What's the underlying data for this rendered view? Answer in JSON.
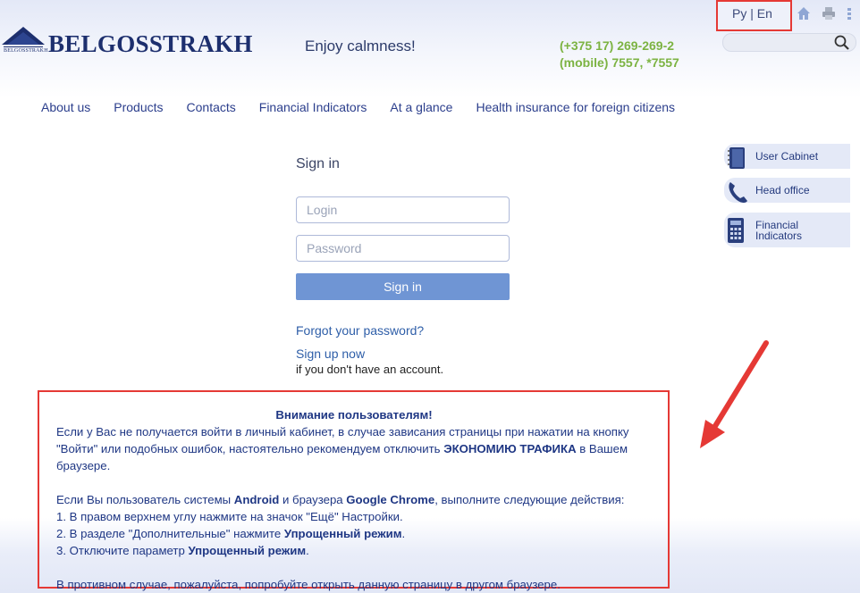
{
  "header": {
    "logo_small": "BELGOSSTRAKH",
    "logo_text": "BELGOSSTRAKH",
    "slogan": "Enjoy calmness!",
    "phone_line1": "(+375 17) 269-269-2",
    "phone_line2": "(mobile) 7557, *7557",
    "lang_ru": "Ру",
    "lang_sep": "|",
    "lang_en": "En"
  },
  "nav": [
    "About us",
    "Products",
    "Contacts",
    "Financial Indicators",
    "At a glance",
    "Health insurance for foreign citizens"
  ],
  "signin": {
    "title": "Sign in",
    "login_placeholder": "Login",
    "password_placeholder": "Password",
    "button": "Sign in",
    "forgot": "Forgot your password?",
    "signup": "Sign up now",
    "no_account": "if you don't have an account."
  },
  "side": {
    "user_cabinet": "User Cabinet",
    "head_office": "Head office",
    "financial_line1": "Financial",
    "financial_line2": "Indicators"
  },
  "notice": {
    "title": "Внимание пользователям!",
    "p1_a": "Если у Вас не получается войти в личный кабинет, в случае зависания страницы при нажатии на кнопку \"Войти\" или подобных ошибок, настоятельно рекомендуем отключить ",
    "p1_b": "ЭКОНОМИЮ ТРАФИКА",
    "p1_c": " в Вашем браузере.",
    "p2_a": "Если Вы пользователь системы ",
    "p2_b": "Android",
    "p2_c": " и браузера ",
    "p2_d": "Google Chrome",
    "p2_e": ", выполните следующие действия:",
    "step1": "1. В правом верхнем углу нажмите на значок \"Ещё\" Настройки.",
    "step2_a": "2. В разделе \"Дополнительные\" нажмите ",
    "step2_b": "Упрощенный режим",
    "step2_c": ".",
    "step3_a": "3. Отключите параметр ",
    "step3_b": "Упрощенный режим",
    "step3_c": ".",
    "p3": "В противном случае, пожалуйста, попробуйте открыть данную страницу в другом браузере."
  },
  "colors": {
    "brand": "#1d2f6e",
    "phone": "#7cb342",
    "button": "#6f95d4",
    "highlight": "#e53935"
  }
}
